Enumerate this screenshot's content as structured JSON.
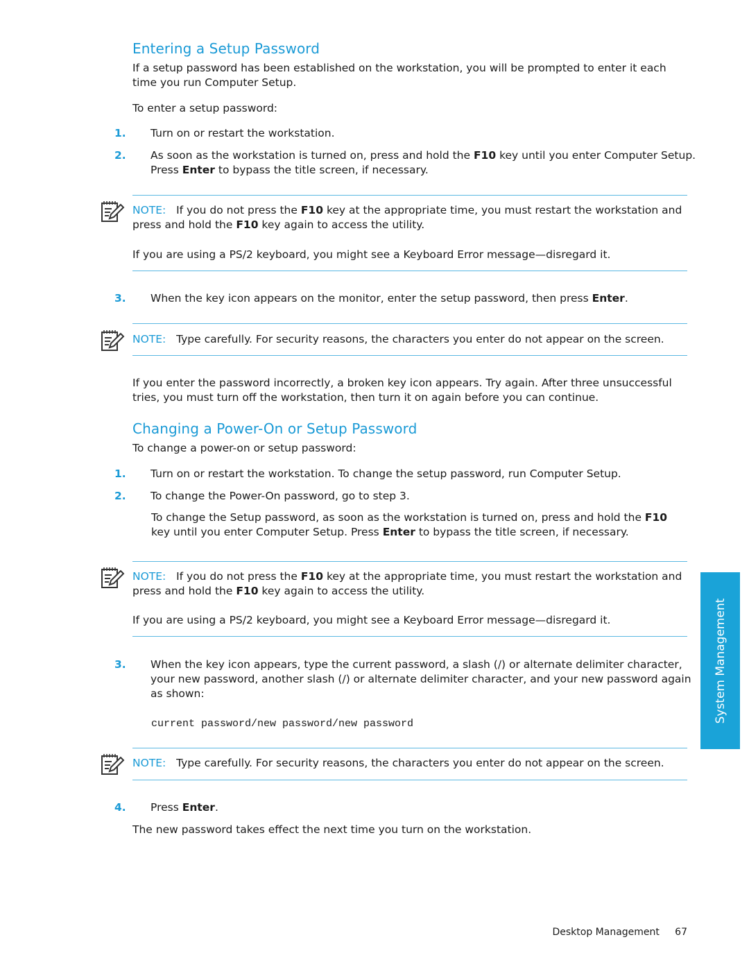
{
  "section1": {
    "heading": "Entering a Setup Password",
    "intro": "If a setup password has been established on the workstation, you will be prompted to enter it each time you run Computer Setup.",
    "lead": "To enter a setup password:",
    "step1": {
      "num": "1.",
      "text": "Turn on or restart the workstation."
    },
    "step2": {
      "num": "2.",
      "pre": "As soon as the workstation is turned on, press and hold the ",
      "key1": "F10",
      "mid": " key until you enter Computer Setup. Press ",
      "key2": "Enter",
      "post": " to bypass the title screen, if necessary."
    },
    "note1": {
      "label": "NOTE:",
      "pre": "If you do not press the ",
      "key1": "F10",
      "mid": " key at the appropriate time, you must restart the workstation and press and hold the ",
      "key2": "F10",
      "post": " key again to access the utility.",
      "extra": "If you are using a PS/2 keyboard, you might see a Keyboard Error message—disregard it."
    },
    "step3": {
      "num": "3.",
      "pre": "When the key icon appears on the monitor, enter the setup password, then press ",
      "key": "Enter",
      "post": "."
    },
    "note2": {
      "label": "NOTE:",
      "text": "Type carefully. For security reasons, the characters you enter do not appear on the screen."
    },
    "outro": "If you enter the password incorrectly, a broken key icon appears. Try again. After three unsuccessful tries, you must turn off the workstation, then turn it on again before you can continue."
  },
  "section2": {
    "heading": "Changing a Power-On or Setup Password",
    "lead": "To change a power-on or setup password:",
    "step1": {
      "num": "1.",
      "text": "Turn on or restart the workstation. To change the setup password, run Computer Setup."
    },
    "step2": {
      "num": "2.",
      "text": "To change the Power-On password, go to step 3."
    },
    "step2b": {
      "pre": "To change the Setup password, as soon as the workstation is turned on, press and hold the ",
      "key1": "F10",
      "mid": " key until you enter Computer Setup. Press ",
      "key2": "Enter",
      "post": " to bypass the title screen, if necessary."
    },
    "note1": {
      "label": "NOTE:",
      "pre": "If you do not press the ",
      "key1": "F10",
      "mid": " key at the appropriate time, you must restart the workstation and press and hold the ",
      "key2": "F10",
      "post": " key again to access the utility.",
      "extra": "If you are using a PS/2 keyboard, you might see a Keyboard Error message—disregard it."
    },
    "step3": {
      "num": "3.",
      "text": "When the key icon appears, type the current password, a slash (/) or alternate delimiter character, your new password, another slash (/) or alternate delimiter character, and your new password again as shown:"
    },
    "code": "current password/new password/new password",
    "note2": {
      "label": "NOTE:",
      "text": "Type carefully. For security reasons, the characters you enter do not appear on the screen."
    },
    "step4": {
      "num": "4.",
      "pre": "Press ",
      "key": "Enter",
      "post": "."
    },
    "outro": "The new password takes effect the next time you turn on the workstation."
  },
  "side_tab": {
    "label": "System Management"
  },
  "footer": {
    "section": "Desktop Management",
    "page": "67"
  },
  "colors": {
    "accent": "#1a9ad6",
    "tab": "#1aa3d8"
  }
}
